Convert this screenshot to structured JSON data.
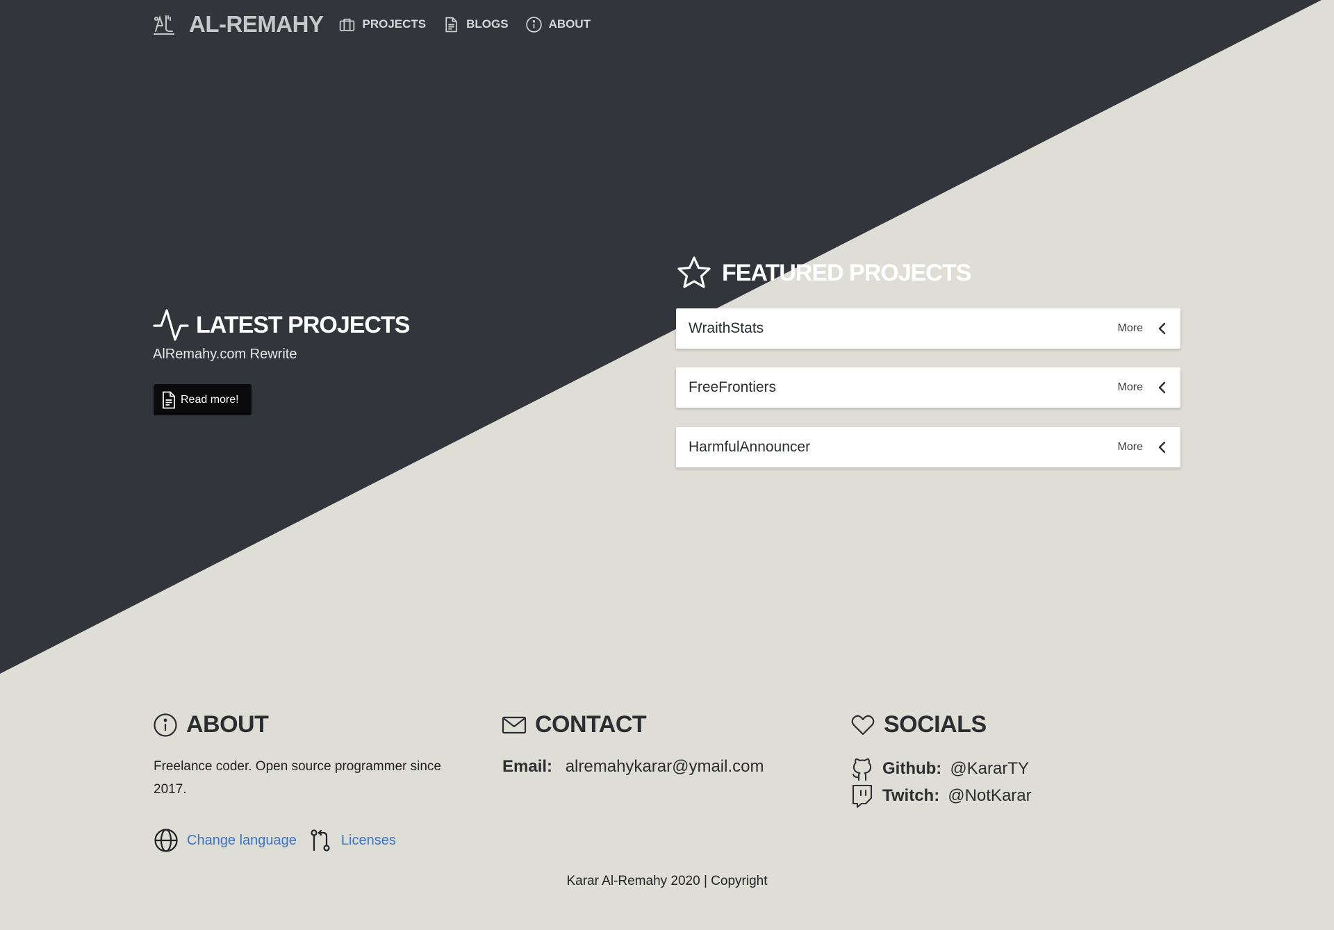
{
  "colors": {
    "dark_bg": "#32363a",
    "light_bg": "#dfded6",
    "card_bg": "#ffffff",
    "link": "#3b73c7",
    "button_bg": "#0b0b0b"
  },
  "nav": {
    "brand": "AL-REMAHY",
    "logo_icon": "al-monogram-logo",
    "items": [
      {
        "label": "PROJECTS",
        "icon": "briefcase-icon"
      },
      {
        "label": "BLOGS",
        "icon": "document-icon"
      },
      {
        "label": "ABOUT",
        "icon": "info-icon"
      }
    ]
  },
  "latest": {
    "heading": "LATEST PROJECTS",
    "icon": "activity-pulse-icon",
    "project": "AlRemahy.com Rewrite",
    "button_label": "Read more!"
  },
  "featured": {
    "heading": "FEATURED PROJECTS",
    "icon": "star-icon",
    "more_label": "More",
    "items": [
      {
        "name": "WraithStats"
      },
      {
        "name": "FreeFrontiers"
      },
      {
        "name": "HarmfulAnnouncer"
      }
    ]
  },
  "footer": {
    "about": {
      "title": "ABOUT",
      "icon": "info-icon",
      "text": "Freelance coder. Open source programmer since 2017."
    },
    "links": [
      {
        "label": "Change language",
        "icon": "globe-icon"
      },
      {
        "label": "Licenses",
        "icon": "git-compare-icon"
      }
    ],
    "contact": {
      "title": "CONTACT",
      "icon": "mail-icon",
      "email_label": "Email:",
      "email": "alremahykarar@ymail.com"
    },
    "socials": {
      "title": "SOCIALS",
      "icon": "heart-icon",
      "items": [
        {
          "label": "Github:",
          "handle": "@KararTY",
          "icon": "github-icon"
        },
        {
          "label": "Twitch:",
          "handle": "@NotKarar",
          "icon": "twitch-icon"
        }
      ]
    },
    "copyright": "Karar Al-Remahy 2020 | Copyright"
  }
}
